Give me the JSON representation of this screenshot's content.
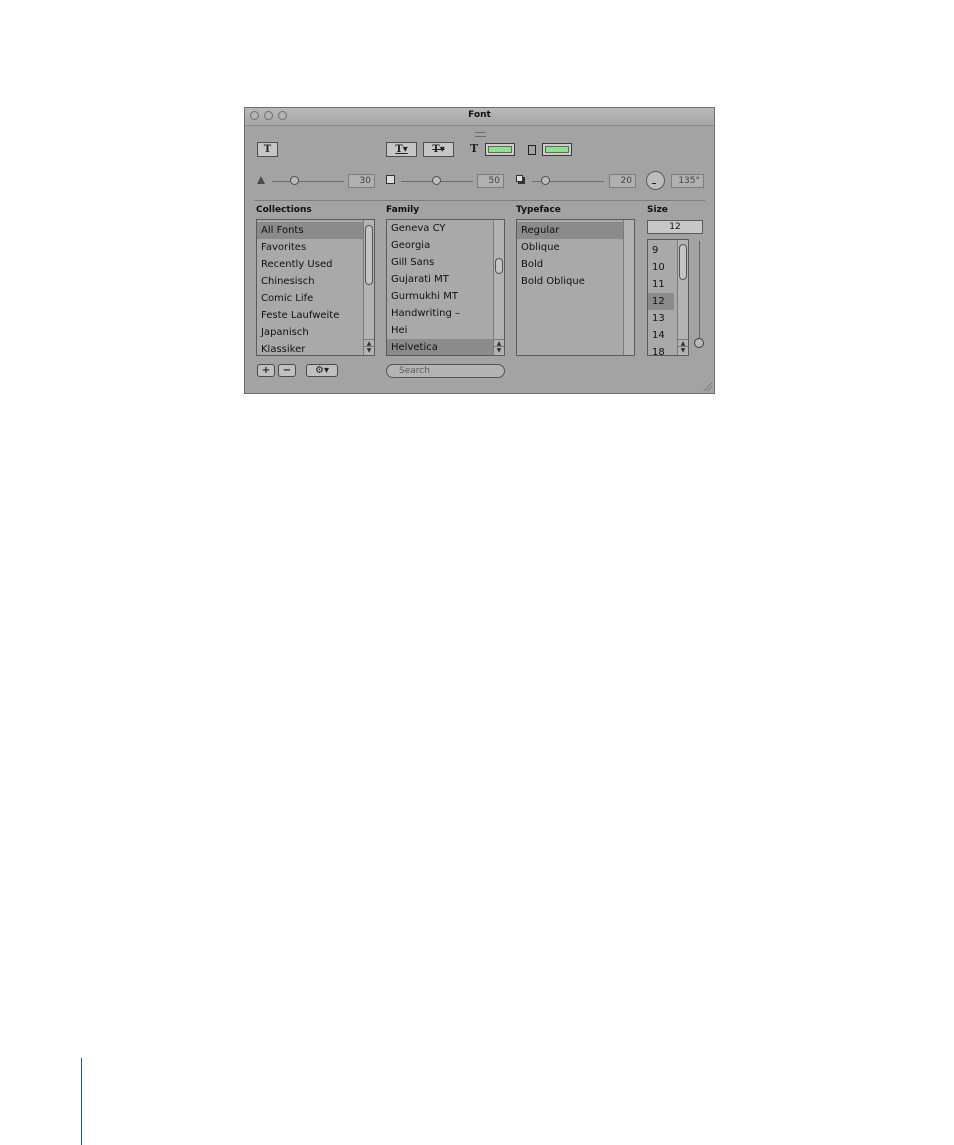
{
  "window": {
    "title": "Font"
  },
  "toolbar": {
    "text_button": "T",
    "underline_button": "T▾",
    "strike_button": "T▾",
    "text_color_glyph": "T",
    "text_color": "#8ee28e",
    "doc_color": "#8ee28e"
  },
  "shadow": {
    "opacity_value": "30",
    "blur_value": "50",
    "offset_value": "20",
    "angle_value": "135°"
  },
  "headers": {
    "collections": "Collections",
    "family": "Family",
    "typeface": "Typeface",
    "size": "Size"
  },
  "collections": [
    "All Fonts",
    "Favorites",
    "Recently Used",
    "Chinesisch",
    "Comic Life",
    "Feste Laufweite",
    "Japanisch",
    "Klassiker"
  ],
  "families": [
    "Geneva CY",
    "Georgia",
    "Gill Sans",
    "Gujarati MT",
    "Gurmukhi MT",
    "Handwriting –",
    "Hei",
    "Helvetica"
  ],
  "typefaces": [
    "Regular",
    "Oblique",
    "Bold",
    "Bold Oblique"
  ],
  "size": {
    "value": "12",
    "list": [
      "9",
      "10",
      "11",
      "12",
      "13",
      "14",
      "18"
    ]
  },
  "buttons": {
    "add": "+",
    "remove": "−",
    "action": "⚙▾"
  },
  "search": {
    "placeholder": "Search"
  }
}
